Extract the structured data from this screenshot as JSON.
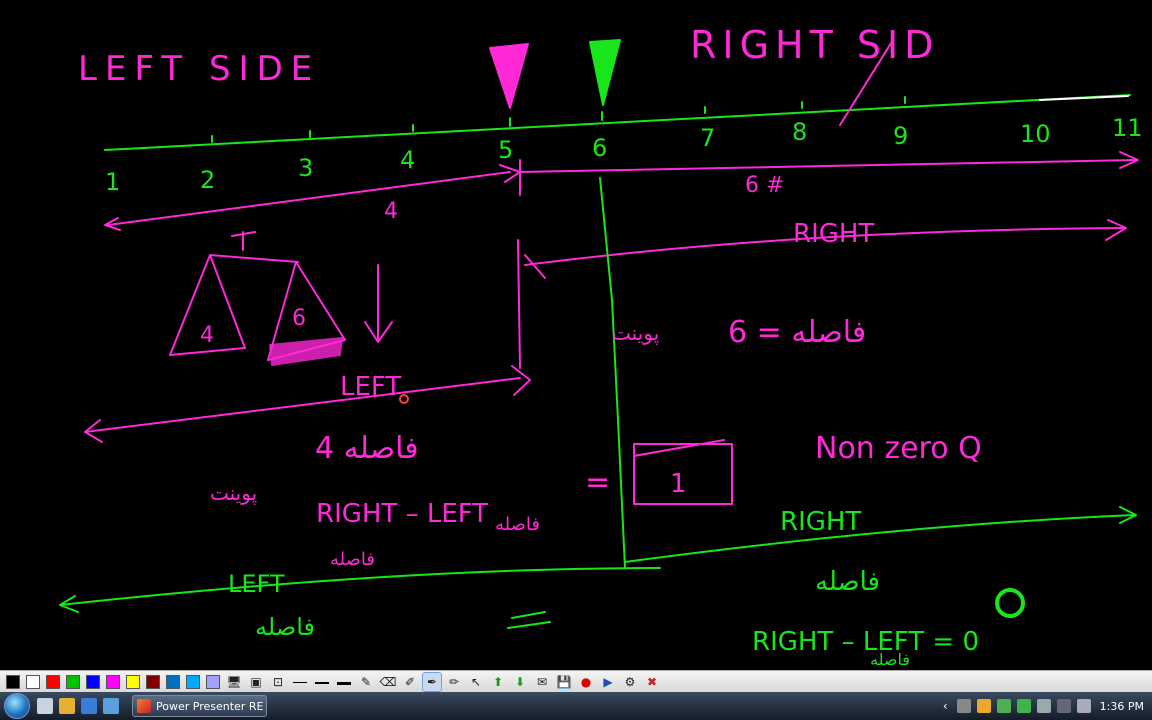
{
  "whiteboard": {
    "pink_color": "#ff29d8",
    "green_color": "#19e61a",
    "labels": {
      "left_side": "LEFT SIDE",
      "right_side": "RIGHT SID",
      "count_left": "4",
      "count_right": "6 #",
      "right_arrow": "RIGHT",
      "left_arrow": "LEFT",
      "pan_left": "4",
      "pan_right": "6",
      "distance_six": "6 = فاصله",
      "distance_four": "4 فاصله",
      "nonzero": "Non zero Q",
      "right_minus_left": "RIGHT – LEFT",
      "equals": "=",
      "box_value": "1",
      "left_row": "LEFT",
      "right_row": "RIGHT",
      "right_left_zero": "RIGHT – LEFT = 0",
      "faseleh_a": "فاصله",
      "faseleh_b": "فاصله",
      "faseleh_c": "فاصله",
      "faseleh_d": "فاصله",
      "faseleh_e": "فاصله",
      "point": "پوینت",
      "point_b": "پوینت"
    },
    "axis_ticks": [
      "1",
      "2",
      "3",
      "4",
      "5",
      "6",
      "7",
      "8",
      "9",
      "10",
      "11"
    ]
  },
  "toolbar": {
    "colors": [
      "#000000",
      "#ffffff",
      "#ff0000",
      "#00c000",
      "#0000ff",
      "#ff00ff",
      "#ffff00",
      "#800000",
      "#0070c0",
      "#00aaff",
      "#a0a0ff"
    ]
  },
  "taskbar": {
    "app_button_label": "Power Presenter RE",
    "clock": "1:36 PM"
  }
}
